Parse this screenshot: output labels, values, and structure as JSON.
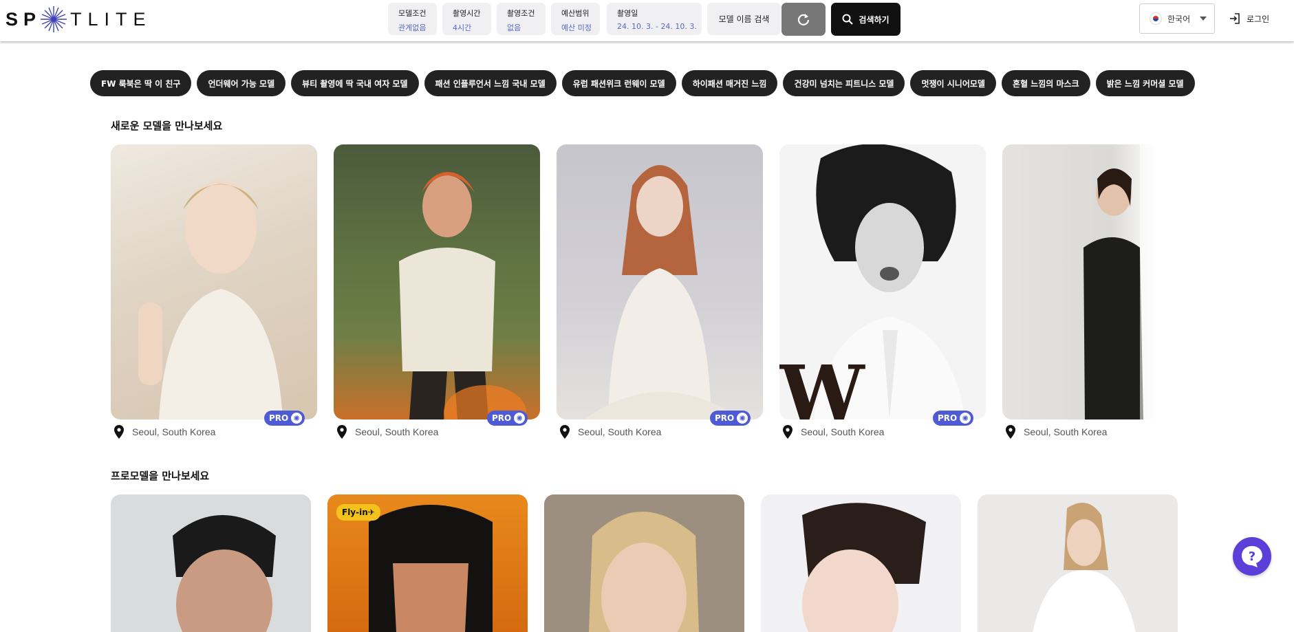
{
  "header": {
    "logo_start": "SP",
    "logo_end": "TLITE",
    "filters": [
      {
        "label": "모델조건",
        "value": "관계없음"
      },
      {
        "label": "촬영시간",
        "value": "4시간"
      },
      {
        "label": "촬영조건",
        "value": "없음"
      },
      {
        "label": "예산범위",
        "value": "예산 미정"
      },
      {
        "label": "촬영일",
        "value": "24. 10. 3. - 24. 10. 3."
      }
    ],
    "name_search_label": "모델 이름 검색",
    "search_label": "검색하기",
    "language": "한국어",
    "login_label": "로그인"
  },
  "tags": [
    "FW 룩북은 딱 이 친구",
    "언더웨어 가능 모델",
    "뷰티 촬영에 딱 국내 여자 모델",
    "패션 인플루언서 느낌 국내 모델",
    "유럽 패션위크 런웨이 모델",
    "하이패션 매거진 느낌",
    "건강미 넘치는 피트니스 모델",
    "멋쟁이 시니어모델",
    "혼혈 느낌의 마스크",
    "밝은 느낌 커머셜 모델"
  ],
  "new_models": {
    "title": "새로운 모델을 만나보세요",
    "cards": [
      {
        "location": "Seoul, South Korea",
        "badge": "PRO"
      },
      {
        "location": "Seoul, South Korea",
        "badge": "PRO"
      },
      {
        "location": "Seoul, South Korea",
        "badge": "PRO"
      },
      {
        "location": "Seoul, South Korea",
        "badge": "PRO"
      },
      {
        "location": "Seoul, South Korea",
        "badge": ""
      }
    ]
  },
  "pro_models": {
    "title": "프로모델을 만나보세요",
    "flyin_badge": "Fly-in"
  },
  "colors": {
    "accent": "#4f5bd5",
    "chip_bg": "#222222",
    "help_button": "#5a3fd8",
    "flyin": "#f5c21b"
  },
  "icons": [
    "search-icon",
    "refresh-icon",
    "login-icon",
    "location-pin-icon",
    "help-icon",
    "gear-icon",
    "flag-kr-icon",
    "plane-icon"
  ]
}
